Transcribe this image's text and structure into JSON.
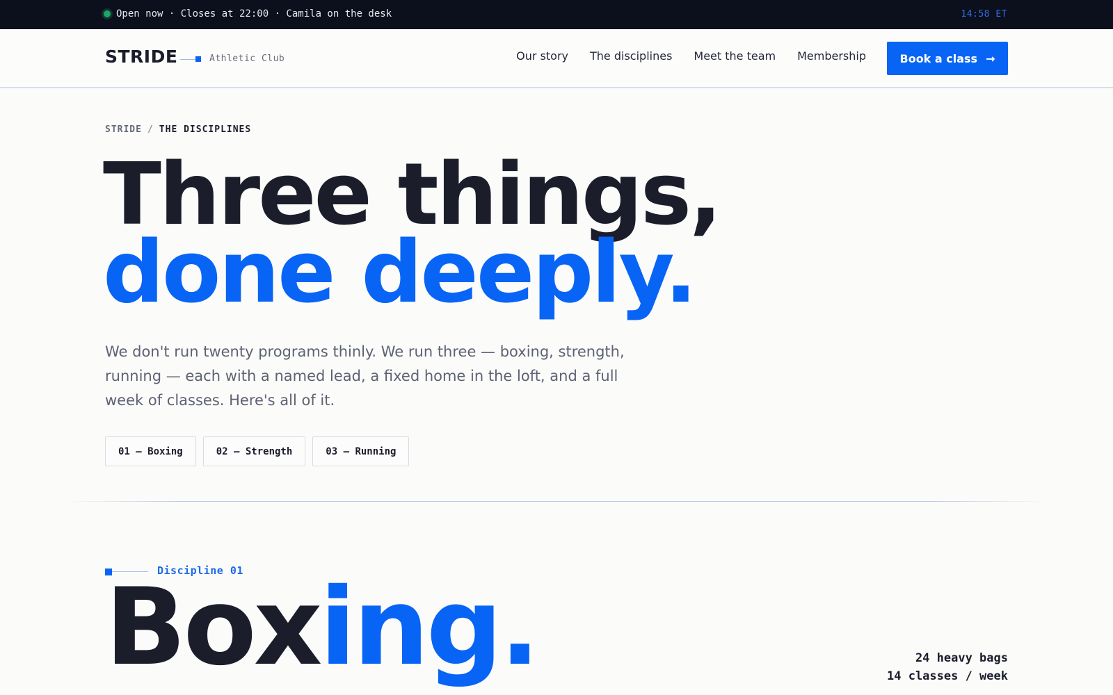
{
  "topbar": {
    "status_text": "Open now · Closes at 22:00 · Camila on the desk",
    "clock": "14:58 ET",
    "status_color": "#1fa36a"
  },
  "header": {
    "brand": "STRIDE",
    "brand_sub": "Athletic Club",
    "nav": [
      "Our story",
      "The disciplines",
      "Meet the team",
      "Membership"
    ],
    "cta_label": "Book a class",
    "cta_icon": "arrow-right-icon"
  },
  "breadcrumb": {
    "root": "STRIDE",
    "separator": "/",
    "current": "THE DISCIPLINES"
  },
  "hero": {
    "title_line1": "Three things,",
    "title_line2": "done deeply.",
    "lead": "We don't run twenty programs thinly. We run three — boxing, strength, running — each with a named lead, a fixed home in the loft, and a full week of classes. Here's all of it.",
    "chips": [
      "01 — Boxing",
      "02 — Strength",
      "03 — Running"
    ]
  },
  "discipline": {
    "label": "Discipline 01",
    "title_part1": "Box",
    "title_part2": "ing.",
    "stats": [
      "24 heavy bags",
      "14 classes / week"
    ]
  },
  "colors": {
    "accent": "#0864f5",
    "ink": "#1b1d2b",
    "topbar_bg": "#0c0f1c"
  }
}
